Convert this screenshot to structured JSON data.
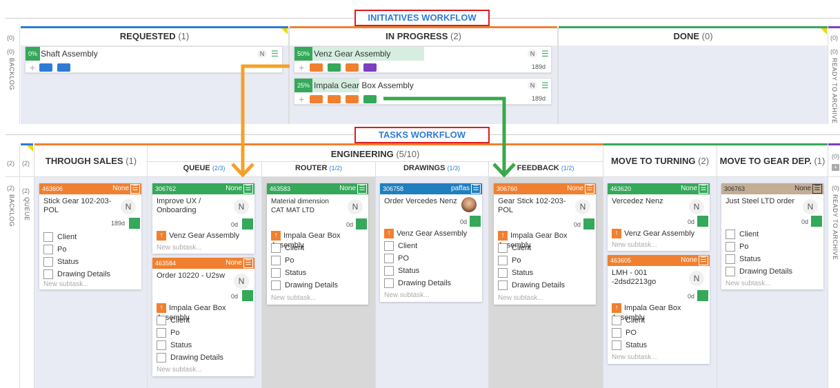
{
  "initiatives": {
    "title": "INITIATIVES WORKFLOW",
    "left_count": "(0)",
    "right_count": "(0)",
    "backlog_count": "(0)",
    "backlog_label": "BACKLOG",
    "archive_count": "(0)",
    "archive_label": "READY TO ARCHIVE",
    "columns": [
      {
        "name": "REQUESTED",
        "count": "(1)",
        "color": "#2e7bd6"
      },
      {
        "name": "IN PROGRESS",
        "count": "(2)",
        "color": "#f08030"
      },
      {
        "name": "DONE",
        "count": "(0)",
        "color": "#35a85a"
      }
    ],
    "cards": [
      {
        "pct": "0%",
        "title": "Shaft Assembly",
        "avatar": "N",
        "days": ""
      },
      {
        "pct": "50%",
        "title": "Venz Gear Assembly",
        "avatar": "N",
        "days": "189d"
      },
      {
        "pct": "25%",
        "title": "Impala Gear Box Assembly",
        "avatar": "N",
        "days": "189d"
      }
    ]
  },
  "tasks": {
    "title": "TASKS WORKFLOW",
    "left_count_a": "(2)",
    "left_count_b": "(2)",
    "queue_count_a": "(2)",
    "queue_count_b": "(2)",
    "queue_label": "QUEUE",
    "backlog_label": "BACKLOG",
    "right_count": "(0)",
    "right_count_b": "(0)",
    "archive_label": "READY TO ARCHIVE",
    "columns": {
      "through_sales": {
        "name": "THROUGH SALES",
        "count": "(1)"
      },
      "engineering": {
        "name": "ENGINEERING",
        "count": "(5/10)"
      },
      "queue": {
        "name": "QUEUE",
        "count": "(2/3)"
      },
      "router": {
        "name": "ROUTER",
        "count": "(1/2)"
      },
      "drawings": {
        "name": "DRAWINGS",
        "count": "(1/3)"
      },
      "feedback": {
        "name": "FEEDBACK",
        "count": "(1/2)"
      },
      "move_turning": {
        "name": "MOVE TO TURNING",
        "count": "(2)"
      },
      "move_gear": {
        "name": "MOVE TO GEAR DEP.",
        "count": "(1)"
      }
    },
    "cards": {
      "c463606": {
        "id": "463606",
        "owner": "None",
        "title": "Stick Gear 102-203-POL",
        "avatar": "N",
        "days": "189d",
        "items": [
          "Client",
          "Po",
          "Status",
          "Drawing Details"
        ],
        "new_subtask": "New subtask..."
      },
      "c306762": {
        "id": "306762",
        "owner": "None",
        "title": "Improve UX / Onboarding",
        "avatar": "N",
        "days": "0d",
        "link": "Venz Gear Assembly",
        "new_subtask": "New subtask..."
      },
      "c463584": {
        "id": "463584",
        "owner": "None",
        "title": "Order 10220 - U2sw",
        "avatar": "N",
        "days": "0d",
        "link": "Impala Gear Box Assembly",
        "items": [
          "Client",
          "Po",
          "Status",
          "Drawing Details"
        ],
        "new_subtask": "New subtask..."
      },
      "c463583": {
        "id": "463583",
        "owner": "None",
        "title": "Material dimension CAT MAT LTD",
        "avatar": "N",
        "days": "0d",
        "link": "Impala Gear Box Assembly",
        "items": [
          "Client",
          "Po",
          "Status",
          "Drawing Details"
        ],
        "new_subtask": "New subtask..."
      },
      "c306758": {
        "id": "306758",
        "owner": "paffas",
        "title": "Order Vercedes Nenz",
        "days": "0d",
        "link": "Venz Gear Assembly",
        "items": [
          "Client",
          "PO",
          "Status",
          "Drawing Details"
        ],
        "new_subtask": "New subtask..."
      },
      "c306760": {
        "id": "306760",
        "owner": "None",
        "title": "Gear Stick 102-203-POL",
        "avatar": "N",
        "days": "0d",
        "link": "Impala Gear Box Assembly",
        "items": [
          "Client",
          "Po",
          "Status",
          "Drawing Details"
        ],
        "new_subtask": "New subtask..."
      },
      "c463620": {
        "id": "463620",
        "owner": "None",
        "title": "Vercedez Nenz",
        "avatar": "N",
        "days": "0d",
        "link": "Venz Gear Assembly",
        "new_subtask": "New subtask..."
      },
      "c463605": {
        "id": "463605",
        "owner": "None",
        "title": "LMH - 001 -2dsd2213go",
        "avatar": "N",
        "days": "0d",
        "link": "Impala Gear Box Assembly",
        "items": [
          "Client",
          "PO",
          "Status"
        ],
        "new_subtask": "New subtask..."
      },
      "c306763": {
        "id": "306763",
        "owner": "None",
        "title": "Just Steel LTD order",
        "avatar": "N",
        "days": "0d",
        "items": [
          "Client",
          "Po",
          "Status",
          "Drawing Details"
        ],
        "new_subtask": "New subtask..."
      }
    }
  },
  "colors": {
    "orange": "#f08030",
    "green": "#35a85a",
    "blue": "#2e7bd6",
    "purple": "#7b3fbf",
    "teal": "#1f8fbf",
    "tan": "#c2ad95",
    "highlight": "#e01a1a"
  }
}
